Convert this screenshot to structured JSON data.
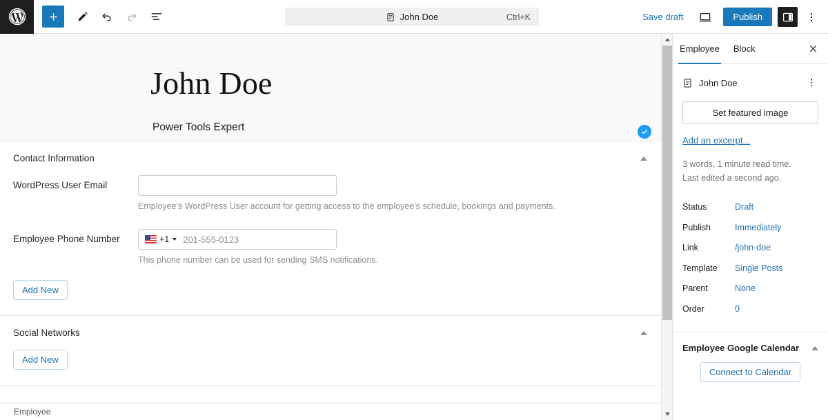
{
  "toolbar": {
    "logo_icon": "wordpress-logo-icon",
    "add_block_label": "+",
    "add_block_icon": "plus-icon",
    "tools_icon": "pencil-icon",
    "undo_icon": "undo-icon",
    "redo_icon": "redo-icon",
    "list_view_icon": "list-view-icon",
    "save_draft_label": "Save draft",
    "preview_icon": "desktop-preview-icon",
    "publish_label": "Publish",
    "settings_toggle_icon": "settings-sidebar-icon",
    "options_icon": "kebab-menu-icon"
  },
  "command_bar": {
    "doc_icon": "document-icon",
    "title": "John Doe",
    "shortcut": "Ctrl+K"
  },
  "canvas": {
    "post_title": "John Doe",
    "post_subtitle": "Power Tools Expert",
    "saved_badge_icon": "check-circle-icon"
  },
  "sections": [
    {
      "title": "Contact Information",
      "collapse_icon": "chevron-up-icon",
      "fields": [
        {
          "label": "WordPress User Email",
          "value": "",
          "placeholder": "",
          "help": "Employee's WordPress User account for getting access to the employee's schedule, bookings and payments."
        },
        {
          "label": "Employee Phone Number",
          "country_flag": "us-flag-icon",
          "dial_code": "+1",
          "value": "",
          "placeholder": "201-555-0123",
          "help": "This phone number can be used for sending SMS notifications."
        }
      ],
      "add_new_label": "Add New"
    },
    {
      "title": "Social Networks",
      "collapse_icon": "chevron-up-icon",
      "add_new_label": "Add New"
    }
  ],
  "sidebar": {
    "tabs": [
      {
        "label": "Employee",
        "active": true
      },
      {
        "label": "Block",
        "active": false
      }
    ],
    "close_icon": "close-icon",
    "document": {
      "icon": "document-icon",
      "title": "John Doe",
      "menu_icon": "kebab-menu-icon"
    },
    "featured_image_label": "Set featured image",
    "excerpt_label": "Add an excerpt...",
    "word_count_note": "3 words, 1 minute read time.",
    "last_edited_note": "Last edited a second ago.",
    "meta": [
      {
        "key": "Status",
        "value": "Draft"
      },
      {
        "key": "Publish",
        "value": "Immediately"
      },
      {
        "key": "Link",
        "value": "/john-doe"
      },
      {
        "key": "Template",
        "value": "Single Posts"
      },
      {
        "key": "Parent",
        "value": "None"
      },
      {
        "key": "Order",
        "value": "0"
      }
    ],
    "calendar_panel": {
      "title": "Employee Google Calendar",
      "collapse_icon": "chevron-up-icon",
      "connect_label": "Connect to Calendar"
    }
  },
  "bottom_bar": {
    "breadcrumb": "Employee"
  },
  "scrollbar": {
    "up_icon": "scroll-up-icon",
    "down_icon": "scroll-down-icon"
  },
  "colors": {
    "accent": "#1878b9",
    "link": "#2271b1",
    "badge": "#1e9cf0",
    "dark": "#1e1e1e"
  }
}
